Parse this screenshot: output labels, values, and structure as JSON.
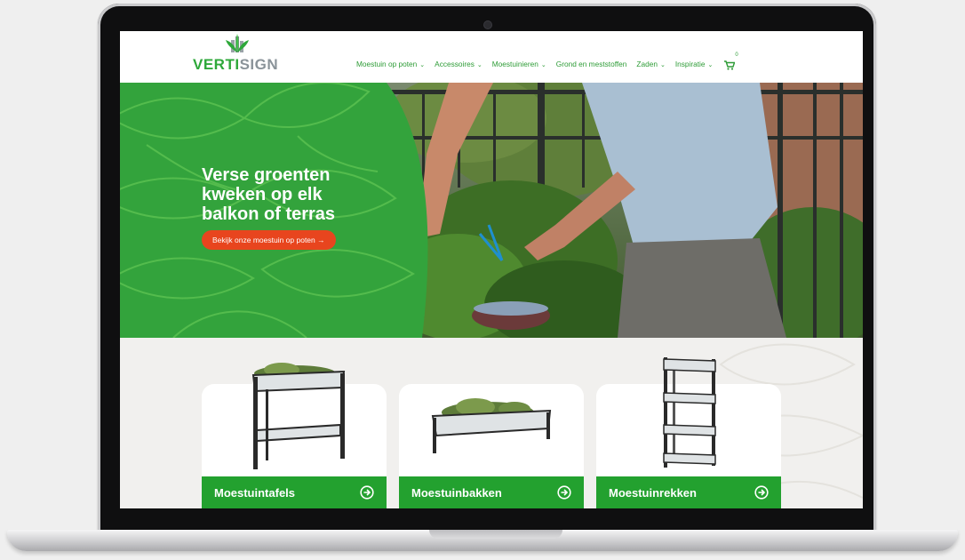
{
  "brand": {
    "logo_part1": "VERTI",
    "logo_part2": "SIGN"
  },
  "nav": {
    "items": [
      {
        "label": "Moestuin op poten",
        "dropdown": true
      },
      {
        "label": "Accessoires",
        "dropdown": true
      },
      {
        "label": "Moestuinieren",
        "dropdown": true
      },
      {
        "label": "Grond en meststoffen",
        "dropdown": false
      },
      {
        "label": "Zaden",
        "dropdown": true
      },
      {
        "label": "Inspiratie",
        "dropdown": true
      }
    ],
    "chevron": "⌄",
    "cart_count": "0"
  },
  "hero": {
    "title": "Verse groenten\nkweken op elk\nbalkon of terras",
    "cta": "Bekijk onze moestuin op poten →"
  },
  "categories": [
    {
      "label": "Moestuintafels"
    },
    {
      "label": "Moestuinbakken"
    },
    {
      "label": "Moestuinrekken"
    }
  ],
  "colors": {
    "brand_green": "#2ea83a",
    "card_bar_green": "#23a12f",
    "cta_orange": "#e8451e",
    "logo_gray": "#8a9399"
  }
}
